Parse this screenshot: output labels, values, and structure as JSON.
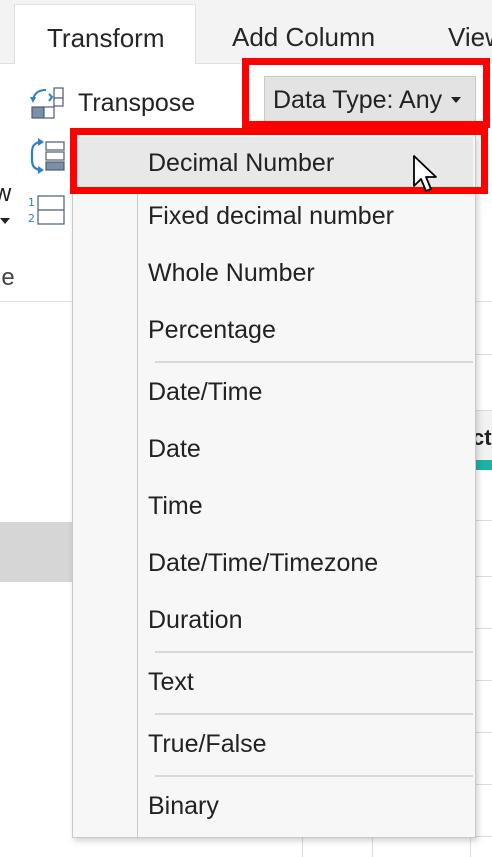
{
  "tabs": [
    {
      "label": "Transform",
      "active": true
    },
    {
      "label": "Add Column",
      "active": false
    },
    {
      "label": "View",
      "active": false
    }
  ],
  "ribbon": {
    "transpose_label": "Transpose",
    "cut_letter": "w",
    "group_label_partial": "le",
    "data_type_label": "Data Type: Any"
  },
  "menu": {
    "items": [
      {
        "label": "Decimal Number",
        "highlighted": true
      },
      {
        "label": "Fixed decimal number"
      },
      {
        "label": "Whole Number"
      },
      {
        "label": "Percentage"
      },
      {
        "label": "Date/Time"
      },
      {
        "label": "Date"
      },
      {
        "label": "Time"
      },
      {
        "label": "Date/Time/Timezone"
      },
      {
        "label": "Duration"
      },
      {
        "label": "Text"
      },
      {
        "label": "True/False"
      },
      {
        "label": "Binary"
      }
    ]
  },
  "grid": {
    "header_partial": "ct"
  },
  "colors": {
    "highlight": "#ff0000",
    "accent_teal": "#1bb3a6",
    "menu_bg": "#f7f7f7",
    "menu_hover": "#e8e8e8"
  },
  "icons": [
    "transpose-icon",
    "reverse-rows-icon",
    "count-rows-icon",
    "chevron-down-icon",
    "mouse-pointer-icon"
  ]
}
